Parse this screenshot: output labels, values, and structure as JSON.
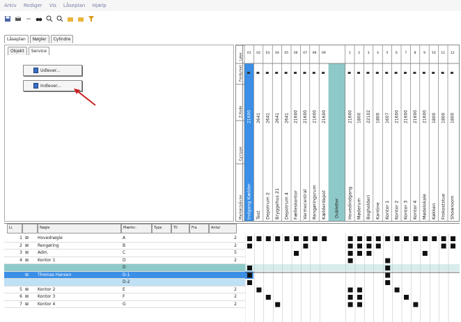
{
  "menu": [
    "Arkiv",
    "Rediger",
    "Vis",
    "Låseplan",
    "Hjælp"
  ],
  "toolbar_icons": [
    "save-icon",
    "print-icon",
    "nav-icon",
    "binoculars-icon",
    "zoom-in-icon",
    "zoom-out-icon",
    "folder-icon",
    "folder-icon",
    "filter-icon"
  ],
  "tabs_top": [
    "Låseplan",
    "Nøgler",
    "Cylindre"
  ],
  "tabs_sub": [
    "Objekt",
    "Service"
  ],
  "buttons": {
    "udlever": "Udlever...",
    "indlever": "Indlever..."
  },
  "vertical_labels": {
    "left_col": [
      "Løse",
      "Fordyrket",
      "Z.Kode",
      "Cyl.type",
      "Markør/påvise"
    ],
    "mid": "Dubletter"
  },
  "columns": {
    "headers": [
      "Li.",
      "",
      "Nøgle",
      "Mærkn.",
      "Type",
      "Til",
      "Fra",
      "Antal"
    ]
  },
  "top_group_a": {
    "numbers": [
      "01",
      "02",
      "03",
      "04",
      "05",
      "06",
      "07",
      "08",
      "09"
    ],
    "names": [
      "Indgang Kælder",
      "Test",
      "Depotrum 2",
      "Bryggehus 21",
      "Depotrum 4",
      "Fælleskontor",
      "Varmecentral",
      "Rengøringsrum",
      "Kælderdepot"
    ],
    "codes": [
      "21600",
      "2641",
      "2641",
      "2641",
      "2641",
      "21600",
      "21600",
      "21600",
      "21600"
    ]
  },
  "top_group_b": {
    "numbers": [
      "1",
      "2",
      "3",
      "4",
      "5",
      "6",
      "7",
      "8",
      "9",
      "10",
      "11",
      "12"
    ],
    "names": [
      "Hovedindgang",
      "Møderum",
      "Bogholderi",
      "Kantine",
      "Kontor 1",
      "Kontor 2",
      "Kontor 3",
      "Kontor 4",
      "Mødelokale",
      "Køkken",
      "Frokoststue",
      "Showroom"
    ],
    "codes": [
      "21600",
      "1800",
      "22102",
      "1800",
      "1607",
      "21600",
      "21600",
      "21600",
      "21600",
      "1800",
      "1800",
      "1800"
    ]
  },
  "rows": [
    {
      "id": "1",
      "name": "Hovednøgle",
      "mark": "A",
      "antal": "2"
    },
    {
      "id": "2",
      "name": "Rengøring",
      "mark": "B",
      "antal": "2"
    },
    {
      "id": "3",
      "name": "Adm.",
      "mark": "C",
      "antal": "5"
    },
    {
      "id": "4",
      "name": "Kontor 1",
      "mark": "D",
      "antal": "2"
    },
    {
      "id": "",
      "name": "",
      "mark": "D",
      "antal": ""
    },
    {
      "id": "",
      "name": "Thomas Hansen",
      "mark": "D-1",
      "antal": ""
    },
    {
      "id": "",
      "name": "",
      "mark": "D-2",
      "antal": ""
    },
    {
      "id": "5",
      "name": "Kontor 2",
      "mark": "E",
      "antal": "2"
    },
    {
      "id": "6",
      "name": "Kontor 3",
      "mark": "F",
      "antal": "2"
    },
    {
      "id": "7",
      "name": "Kontor 4",
      "mark": "G",
      "antal": "2"
    }
  ],
  "colors": {
    "accent": "#3b8fe6",
    "teal": "#8ec9c9",
    "selected": "#3b8fe6",
    "subsel": "#bfe0f5",
    "arrow": "#cc2222"
  }
}
